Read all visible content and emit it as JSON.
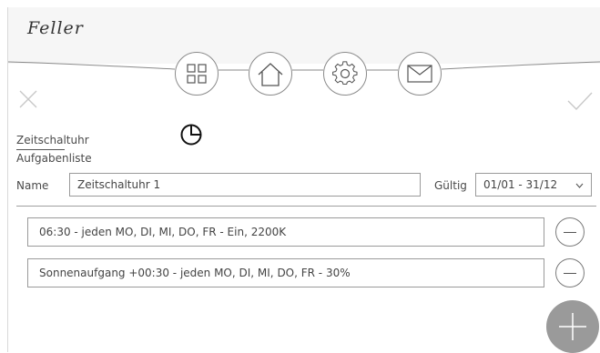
{
  "brand": {
    "logo_text": "Feller"
  },
  "nav": [
    {
      "name": "grid-icon"
    },
    {
      "name": "home-icon"
    },
    {
      "name": "gear-icon"
    },
    {
      "name": "mail-icon"
    }
  ],
  "labels": {
    "zeitschaltuhr": "Zeitschaltuhr",
    "aufgabenliste": "Aufgabenliste",
    "name": "Name",
    "gueltig": "Gültig"
  },
  "form": {
    "name_value": "Zeitschaltuhr 1",
    "range_value": "01/01 - 31/12"
  },
  "tasks": [
    {
      "text": "06:30  -  jeden MO, DI, MI, DO, FR  -  Ein, 2200K"
    },
    {
      "text": "Sonnenaufgang +00:30  -  jeden MO, DI, MI, DO, FR  -   30%"
    }
  ],
  "colors": {
    "accent_gray": "#9a9a9a",
    "line": "#8a8a8a"
  }
}
